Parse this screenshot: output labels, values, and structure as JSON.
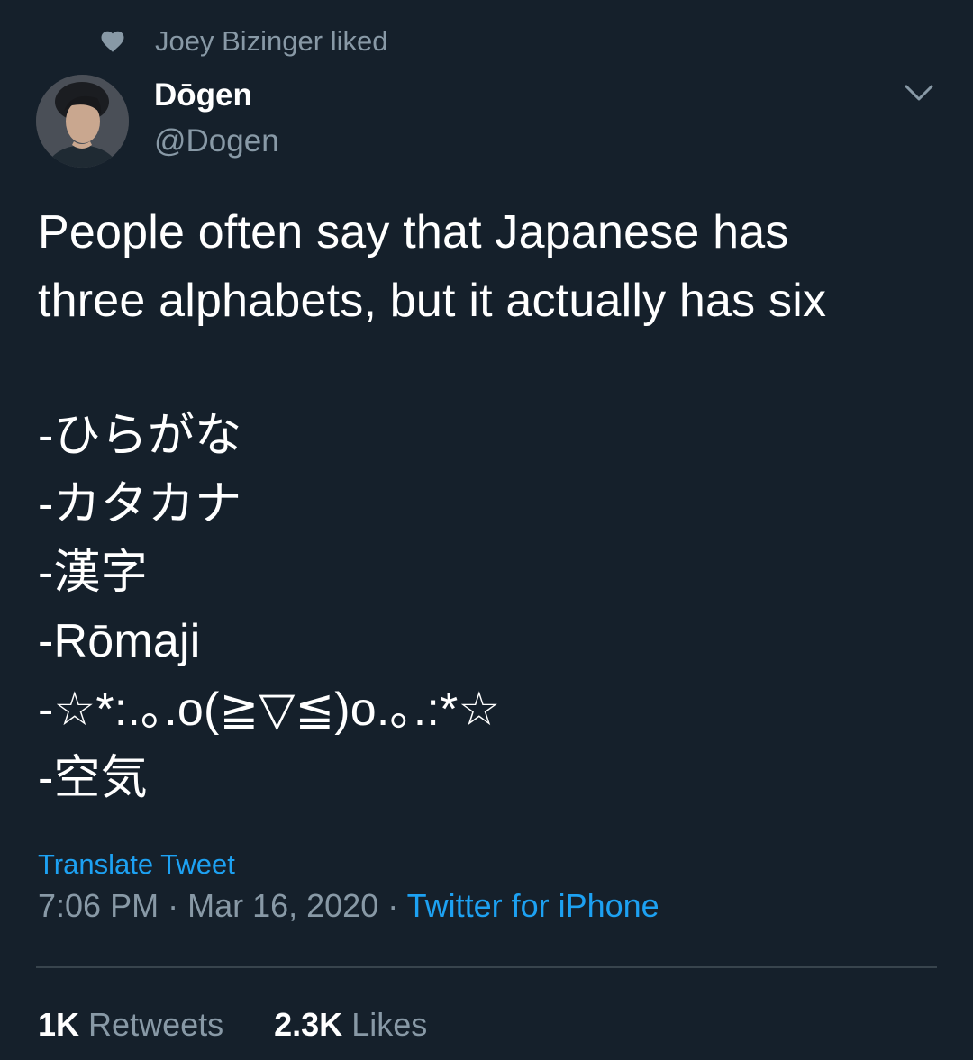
{
  "context": {
    "icon": "heart-icon",
    "text": "Joey Bizinger liked"
  },
  "author": {
    "name": "Dōgen",
    "handle": "@Dogen",
    "avatar_icon": "avatar"
  },
  "menu": {
    "icon": "chevron-down-icon"
  },
  "tweet": {
    "lines": [
      "People often say that Japanese has",
      "three alphabets, but it actually has six",
      "",
      "-ひらがな",
      "-カタカナ",
      "-漢字",
      "-Rōmaji",
      "-☆*:.｡.o(≧▽≦)o.｡.:*☆",
      "-空気"
    ]
  },
  "translate_label": "Translate Tweet",
  "meta": {
    "time": "7:06 PM",
    "separator": " · ",
    "date": "Mar 16, 2020",
    "separator2": " · ",
    "source": "Twitter for iPhone"
  },
  "stats": {
    "retweets_count": "1K",
    "retweets_label": "Retweets",
    "likes_count": "2.3K",
    "likes_label": "Likes"
  },
  "colors": {
    "background": "#15202b",
    "text": "#ffffff",
    "muted": "#8899a6",
    "accent": "#1da1f2",
    "divider": "#38444d"
  }
}
